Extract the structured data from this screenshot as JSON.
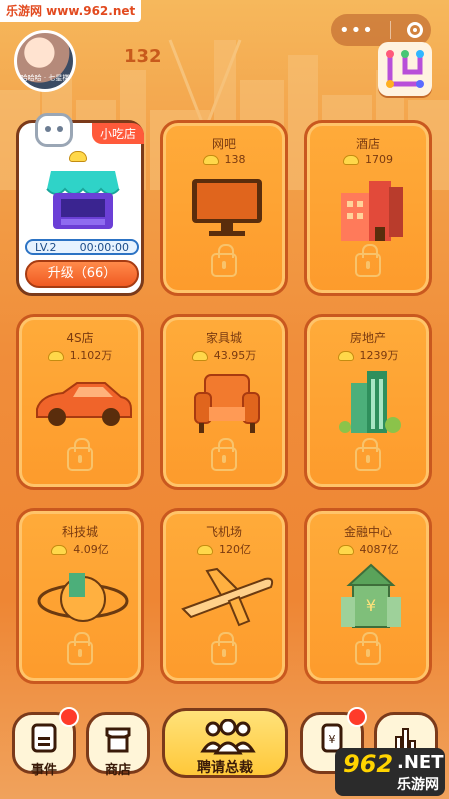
{
  "watermark_top": "乐游网 www.962.net",
  "header": {
    "coins": "132",
    "avatar_caption": "哈哈哈 · 七星楼"
  },
  "active_shop": {
    "tag": "小吃店",
    "level": "LV.2",
    "timer": "00:00:00",
    "upgrade_label": "升级（66）"
  },
  "shops": [
    {
      "name": "网吧",
      "price": "138",
      "icon": "monitor-icon"
    },
    {
      "name": "酒店",
      "price": "1709",
      "icon": "hotel-icon"
    },
    {
      "name": "4S店",
      "price": "1.102万",
      "icon": "car-icon"
    },
    {
      "name": "家具城",
      "price": "43.95万",
      "icon": "armchair-icon"
    },
    {
      "name": "房地产",
      "price": "1239万",
      "icon": "building-icon"
    },
    {
      "name": "科技城",
      "price": "4.09亿",
      "icon": "planet-icon"
    },
    {
      "name": "飞机场",
      "price": "120亿",
      "icon": "airplane-icon"
    },
    {
      "name": "金融中心",
      "price": "4087亿",
      "icon": "finance-icon"
    }
  ],
  "bottom_nav": {
    "events": "事件",
    "store": "商店",
    "hire": "聘请总裁"
  },
  "logo_watermark": {
    "big": "962",
    "net": ".NET",
    "sub": "乐游网"
  },
  "colors": {
    "card": "#fd9b2c",
    "card_border": "#c9581f",
    "accent_red": "#ff3b2a"
  }
}
